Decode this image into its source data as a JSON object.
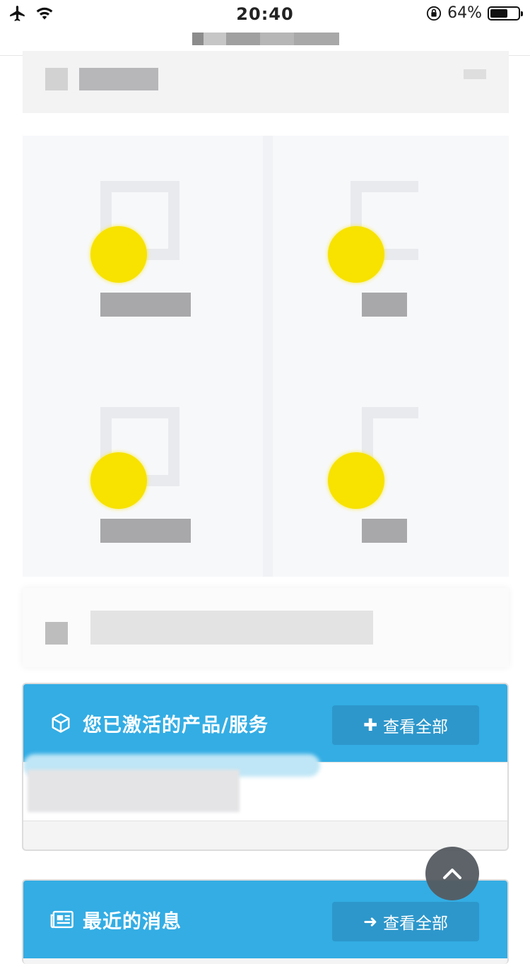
{
  "status_bar": {
    "time": "20:40",
    "battery_percent": "64%",
    "battery_level": 0.64,
    "icons": [
      "airplane-icon",
      "wifi-icon",
      "orientation-lock-icon",
      "battery-icon"
    ]
  },
  "colors": {
    "panel_header": "#33ade4",
    "button": "#2d97cb",
    "accent_dot": "#f7e200",
    "scroll_button": "#555b61"
  },
  "products_panel": {
    "icon": "cube-icon",
    "title": "您已激活的产品/服务",
    "view_all": {
      "icon": "plus-icon",
      "label": "查看全部"
    }
  },
  "news_panel": {
    "icon": "newspaper-icon",
    "title": "最近的消息",
    "view_all": {
      "icon": "arrow-right-icon",
      "label": "查看全部"
    }
  },
  "scroll_top": {
    "icon": "chevron-up-icon"
  }
}
